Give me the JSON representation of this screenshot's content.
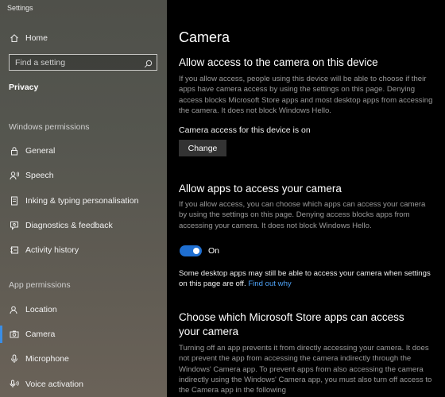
{
  "window": {
    "title": "Settings"
  },
  "sidebar": {
    "home_label": "Home",
    "search_placeholder": "Find a setting",
    "section_title": "Privacy",
    "windows_permissions_header": "Windows permissions",
    "windows_items": [
      {
        "label": "General",
        "icon": "lock-icon"
      },
      {
        "label": "Speech",
        "icon": "speech-icon"
      },
      {
        "label": "Inking & typing personalisation",
        "icon": "inking-icon"
      },
      {
        "label": "Diagnostics & feedback",
        "icon": "diagnostics-icon"
      },
      {
        "label": "Activity history",
        "icon": "activity-icon"
      }
    ],
    "app_permissions_header": "App permissions",
    "app_items": [
      {
        "label": "Location",
        "icon": "location-icon"
      },
      {
        "label": "Camera",
        "icon": "camera-icon",
        "selected": true
      },
      {
        "label": "Microphone",
        "icon": "microphone-icon"
      },
      {
        "label": "Voice activation",
        "icon": "voice-activation-icon"
      }
    ],
    "accent_color": "#3a8ee6"
  },
  "main": {
    "title": "Camera",
    "device_access": {
      "heading": "Allow access to the camera on this device",
      "description": "If you allow access, people using this device will be able to choose if their apps have camera access by using the settings on this page. Denying access blocks Microsoft Store apps and most desktop apps from accessing the camera. It does not block Windows Hello.",
      "status": "Camera access for this device is on",
      "button_label": "Change"
    },
    "app_access": {
      "heading": "Allow apps to access your camera",
      "description": "If you allow access, you can choose which apps can access your camera by using the settings on this page. Denying access blocks apps from accessing your camera. It does not block Windows Hello.",
      "toggle_state": "On",
      "toggle_color": "#1f6fd1",
      "note": "Some desktop apps may still be able to access your camera when settings on this page are off.",
      "link": "Find out why"
    },
    "store_apps": {
      "heading_line1": "Choose which Microsoft Store apps can access",
      "heading_line2": "your camera",
      "description": "Turning off an app prevents it from directly accessing your camera. It does not prevent the app from accessing the camera indirectly through the Windows' Camera app. To prevent apps from also accessing the camera indirectly using the Windows' Camera app, you must also turn off access to the Camera app in the following"
    }
  }
}
